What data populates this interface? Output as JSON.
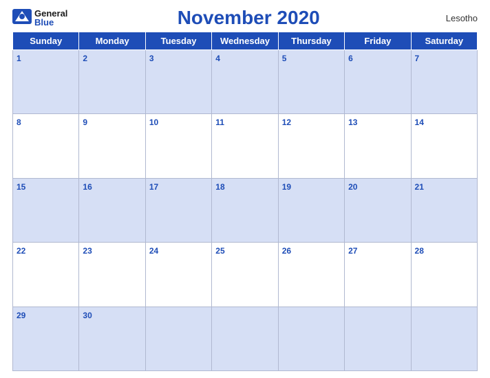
{
  "header": {
    "title": "November 2020",
    "country": "Lesotho",
    "logo_general": "General",
    "logo_blue": "Blue"
  },
  "days_of_week": [
    "Sunday",
    "Monday",
    "Tuesday",
    "Wednesday",
    "Thursday",
    "Friday",
    "Saturday"
  ],
  "weeks": [
    [
      1,
      2,
      3,
      4,
      5,
      6,
      7
    ],
    [
      8,
      9,
      10,
      11,
      12,
      13,
      14
    ],
    [
      15,
      16,
      17,
      18,
      19,
      20,
      21
    ],
    [
      22,
      23,
      24,
      25,
      26,
      27,
      28
    ],
    [
      29,
      30,
      null,
      null,
      null,
      null,
      null
    ]
  ]
}
